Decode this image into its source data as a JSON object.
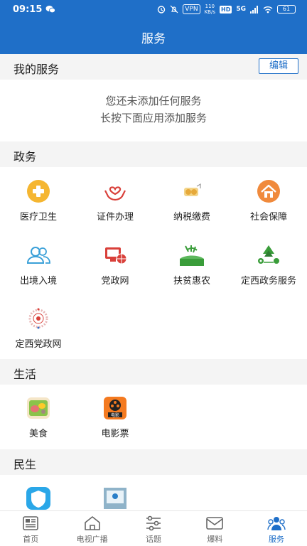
{
  "status_bar": {
    "time": "09:15",
    "vpn": "VPN",
    "speed_top": "110",
    "speed_bottom": "KB/s",
    "hd": "HD",
    "network": "5G",
    "battery": "61"
  },
  "header": {
    "title": "服务"
  },
  "my_services": {
    "title": "我的服务",
    "edit_label": "编辑",
    "empty_line1": "您还未添加任何服务",
    "empty_line2": "长按下面应用添加服务"
  },
  "gov": {
    "title": "政务",
    "items": [
      {
        "label": "医疗卫生",
        "icon": "medical-cross-icon"
      },
      {
        "label": "证件办理",
        "icon": "hands-heart-icon"
      },
      {
        "label": "纳税缴费",
        "icon": "tax-coins-icon"
      },
      {
        "label": "社会保障",
        "icon": "house-icon"
      },
      {
        "label": "出境入境",
        "icon": "people-icon"
      },
      {
        "label": "党政网",
        "icon": "monitor-globe-icon"
      },
      {
        "label": "扶贫惠农",
        "icon": "farm-logo-icon"
      },
      {
        "label": "定西政务服务",
        "icon": "dingxi-gov-logo-icon"
      },
      {
        "label": "定西党政网",
        "icon": "party-emblem-icon"
      }
    ]
  },
  "life": {
    "title": "生活",
    "items": [
      {
        "label": "美食",
        "icon": "food-icon"
      },
      {
        "label": "电影票",
        "icon": "film-ticket-icon"
      }
    ]
  },
  "people": {
    "title": "民生",
    "items": [
      {
        "label": "",
        "icon": "travel-shield-icon"
      },
      {
        "label": "",
        "icon": "screen-app-icon"
      }
    ]
  },
  "bottom_nav": [
    {
      "label": "首页",
      "icon": "news-icon",
      "active": false
    },
    {
      "label": "电视广播",
      "icon": "home-tv-icon",
      "active": false
    },
    {
      "label": "话题",
      "icon": "sliders-icon",
      "active": false
    },
    {
      "label": "爆料",
      "icon": "mail-icon",
      "active": false
    },
    {
      "label": "服务",
      "icon": "people-service-icon",
      "active": true
    }
  ],
  "colors": {
    "brand": "#1f6fc8",
    "section_bg": "#f4f4f4"
  }
}
